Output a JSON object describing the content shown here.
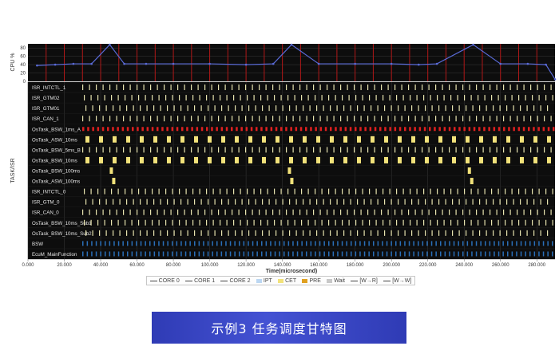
{
  "caption": "示例3 任务调度甘特图",
  "colors": {
    "plot_bg": "#0d0d0d",
    "grid": "#3a3a3a",
    "period_line": "#b01818",
    "cpu_line": "#5a6bd8",
    "isr_tick": "#e8e4b0",
    "task_block": "#f2e27a",
    "red_task": "#e02020",
    "blue_task": "#2a6fb8",
    "caption_bg": "#3a47c4"
  },
  "cpu_panel": {
    "ylabel": "CPU %",
    "yticks": [
      "80",
      "60",
      "40",
      "20",
      "0"
    ]
  },
  "gantt": {
    "ylabel": "TASK/ISR",
    "xlabel": "Time(microsecond)",
    "xticks": [
      "0.000",
      "20.000",
      "40.000",
      "60.000",
      "80.000",
      "100.000",
      "120.000",
      "140.000",
      "160.000",
      "180.000",
      "200.000",
      "220.000",
      "240.000",
      "260.000",
      "280.000"
    ],
    "rows": [
      {
        "label": "ISR_INTCTL_1",
        "style": "tick"
      },
      {
        "label": "ISR_GTM02",
        "style": "tick"
      },
      {
        "label": "ISR_GTM01",
        "style": "tick"
      },
      {
        "label": "ISR_CAN_1",
        "style": "tick"
      },
      {
        "label": "OsTask_BSW_1ms_A",
        "style": "red"
      },
      {
        "label": "OsTask_ASW_10ms",
        "style": "block"
      },
      {
        "label": "OsTask_BSW_5ms_B",
        "style": "tick"
      },
      {
        "label": "OsTask_BSW_10ms",
        "style": "block"
      },
      {
        "label": "OsTask_BSW_100ms",
        "style": "sparse"
      },
      {
        "label": "OsTask_ASW_100ms",
        "style": "sparse"
      },
      {
        "label": "ISR_INTCTL_0",
        "style": "tick"
      },
      {
        "label": "ISR_GTM_0",
        "style": "tick"
      },
      {
        "label": "ISR_CAN_0",
        "style": "tick"
      },
      {
        "label": "OsTask_BSW_10ms_Sub1",
        "style": "tick"
      },
      {
        "label": "OsTask_BSW_10ms_Sub2",
        "style": "tick"
      },
      {
        "label": "BSW",
        "style": "blue"
      },
      {
        "label": "EcuM_MainFunction",
        "style": "blue"
      }
    ]
  },
  "chart_data": {
    "type": "line",
    "title": "",
    "ylabel": "CPU %",
    "xlabel": "Time(microsecond)",
    "xlim": [
      0,
      290000
    ],
    "ylim": [
      0,
      90
    ],
    "x": [
      5000,
      15000,
      25000,
      35000,
      45000,
      53000,
      65000,
      80000,
      100000,
      120000,
      135000,
      145000,
      160000,
      180000,
      200000,
      215000,
      225000,
      245000,
      260000,
      275000,
      285000,
      290000
    ],
    "series": [
      {
        "values": [
          38,
          40,
          42,
          42,
          88,
          42,
          42,
          42,
          42,
          40,
          42,
          88,
          42,
          42,
          42,
          40,
          42,
          88,
          42,
          42,
          40,
          5
        ]
      }
    ]
  },
  "legend": [
    {
      "label": "CORE 0",
      "kind": "line",
      "color": "#444444"
    },
    {
      "label": "CORE 1",
      "kind": "line",
      "color": "#444444"
    },
    {
      "label": "CORE 2",
      "kind": "line",
      "color": "#444444"
    },
    {
      "label": "IPT",
      "kind": "swatch",
      "color": "#bcd7f2"
    },
    {
      "label": "CET",
      "kind": "swatch",
      "color": "#f2e27a"
    },
    {
      "label": "PRE",
      "kind": "swatch",
      "color": "#e0a020"
    },
    {
      "label": "Wait",
      "kind": "swatch",
      "color": "#c8c8c8"
    },
    {
      "label": "[W→R]",
      "kind": "line",
      "color": "#444444"
    },
    {
      "label": "[W→W]",
      "kind": "line",
      "color": "#444444"
    }
  ]
}
